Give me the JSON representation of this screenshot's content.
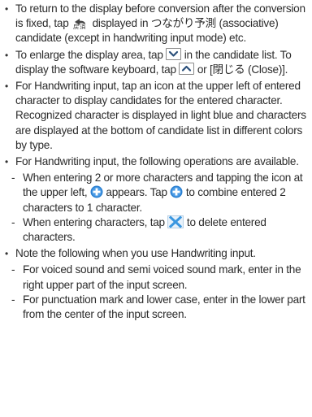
{
  "items": [
    {
      "parts": [
        "To return to the display before conversion after the conversion is fixed, tap ",
        " displayed in つながり予測 (associative) candidate (except in handwriting input mode) etc."
      ]
    },
    {
      "parts": [
        "To enlarge the display area, tap ",
        " in the candidate list. To display the software keyboard, tap ",
        " or [閉じる (Close)]."
      ]
    },
    {
      "text": "For Handwriting input, tap an icon at the upper left of entered character to display candidates for the entered character. Recognized character is displayed in light blue and characters are displayed at the bottom of candidate list in different colors by type."
    },
    {
      "text": "For Handwriting input, the following operations are available.",
      "subs": [
        {
          "parts": [
            "When entering 2 or more characters and tapping the icon at the upper left, ",
            " appears. Tap ",
            " to combine entered 2 characters to 1 character."
          ]
        },
        {
          "parts": [
            "When entering characters, tap ",
            " to delete entered characters."
          ]
        }
      ]
    },
    {
      "text": "Note the following when you use Handwriting input.",
      "subs": [
        {
          "text": "For voiced sound and semi voiced sound mark, enter in the right upper part of the input screen."
        },
        {
          "text": "For punctuation mark and lower case, enter in the lower part from the center of the input screen."
        }
      ]
    }
  ],
  "icons": {
    "undo_label": "戻",
    "colors": {
      "plus": "#2a7fd0",
      "close": "#3b97e0",
      "text": "#2b2b2b"
    }
  }
}
